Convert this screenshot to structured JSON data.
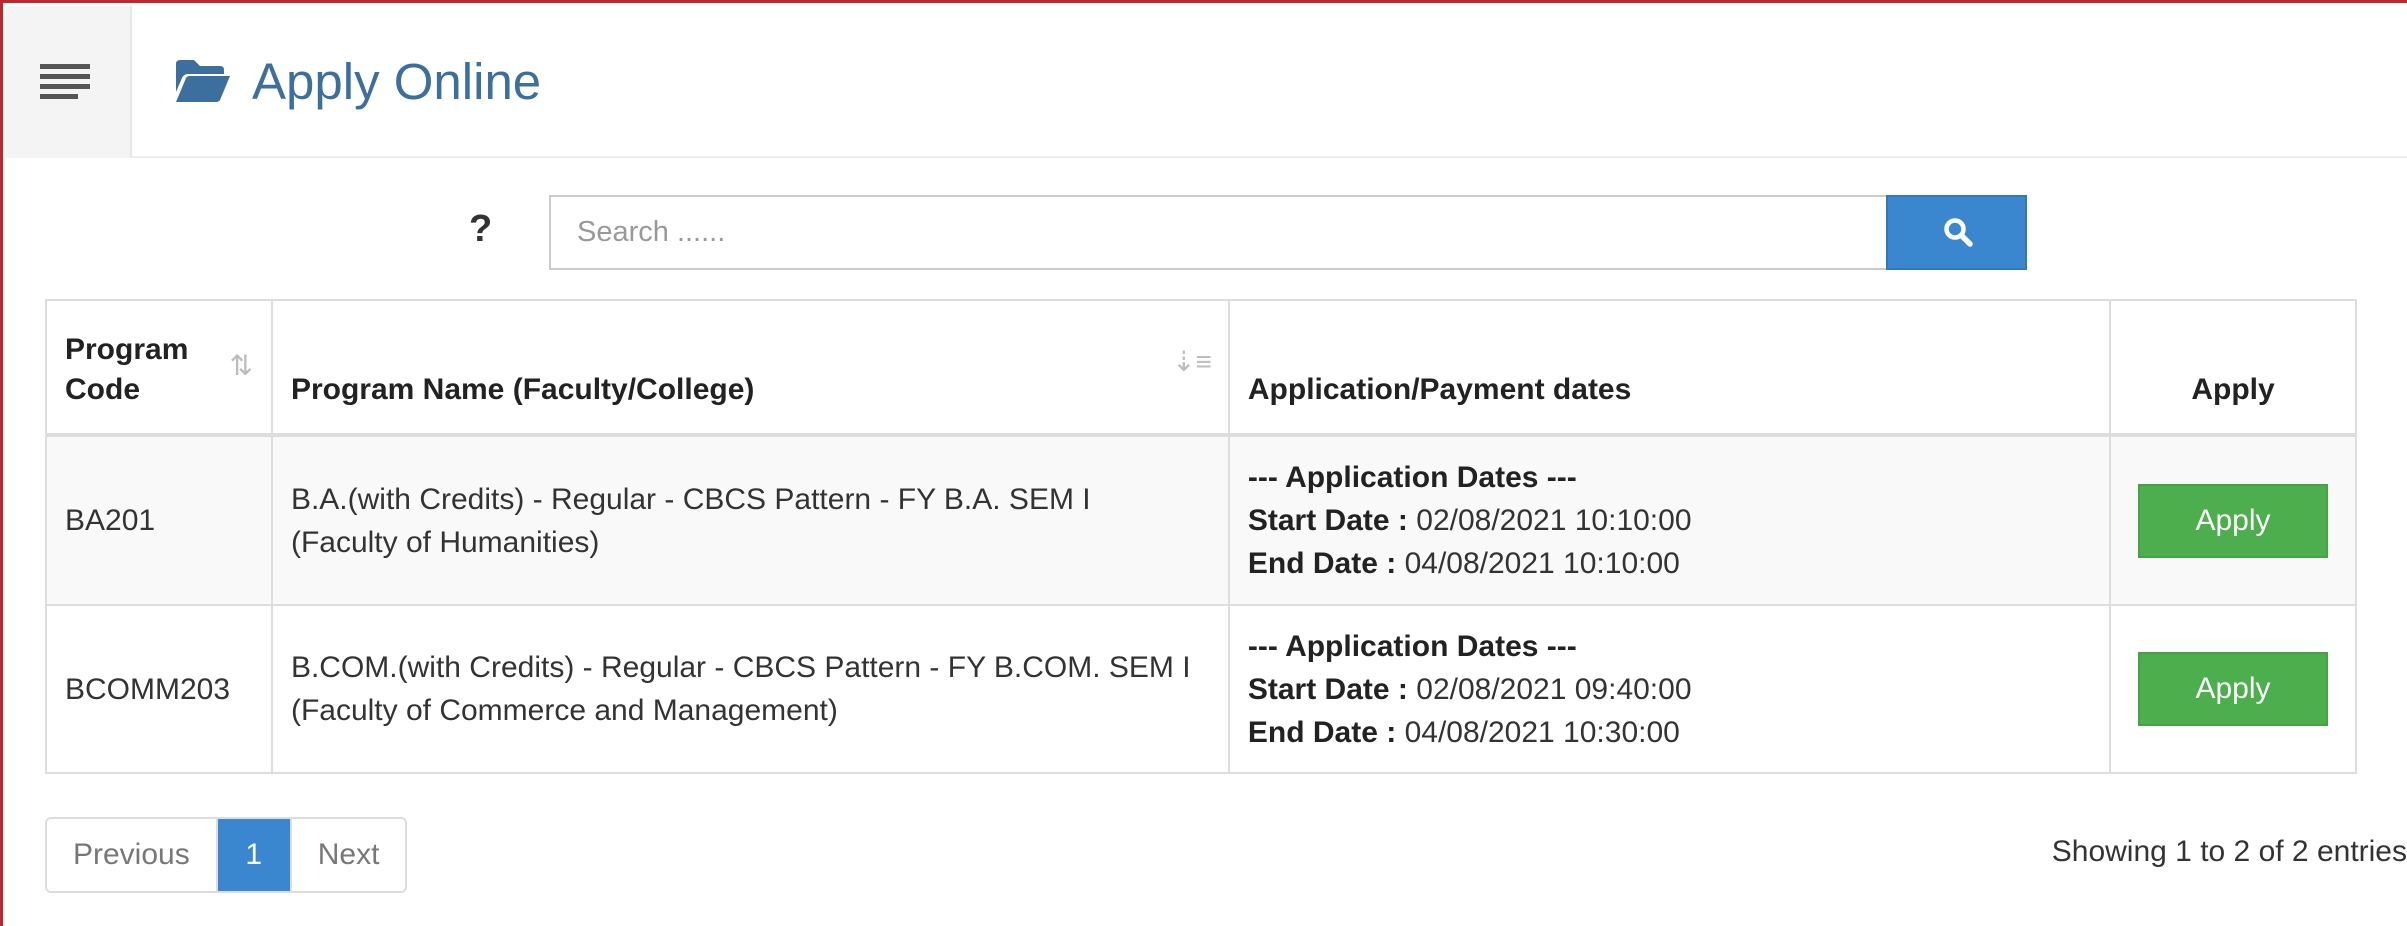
{
  "header": {
    "title": "Apply Online",
    "menu_icon": "hamburger-icon",
    "title_icon": "folder-open-icon"
  },
  "search": {
    "help_label": "?",
    "placeholder": "Search ......",
    "value": "",
    "button_icon": "search-icon"
  },
  "table": {
    "headers": {
      "code_line1": "Program",
      "code_line2": "Code",
      "name": "Program Name (Faculty/College)",
      "dates": "Application/Payment dates",
      "apply": "Apply"
    },
    "rows": [
      {
        "code": "BA201",
        "name_line1": "B.A.(with Credits) - Regular - CBCS Pattern - FY B.A. SEM I",
        "name_line2": "(Faculty of Humanities)",
        "dates_heading": "--- Application Dates ---",
        "start_label": "Start Date :",
        "start_value": " 02/08/2021 10:10:00",
        "end_label": "End Date :",
        "end_value": " 04/08/2021 10:10:00",
        "apply_label": "Apply"
      },
      {
        "code": "BCOMM203",
        "name_line1": "B.COM.(with Credits) - Regular - CBCS Pattern - FY B.COM. SEM I",
        "name_line2": "(Faculty of Commerce and Management)",
        "dates_heading": "--- Application Dates ---",
        "start_label": "Start Date :",
        "start_value": " 02/08/2021 09:40:00",
        "end_label": "End Date :",
        "end_value": " 04/08/2021 10:30:00",
        "apply_label": "Apply"
      }
    ]
  },
  "pagination": {
    "previous": "Previous",
    "current_page": "1",
    "next": "Next",
    "info": "Showing 1 to 2 of 2 entries"
  },
  "colors": {
    "primary": "#3b87cf",
    "success": "#4cae4c",
    "title": "#3c6f9e",
    "frame_border": "#c0272d"
  }
}
